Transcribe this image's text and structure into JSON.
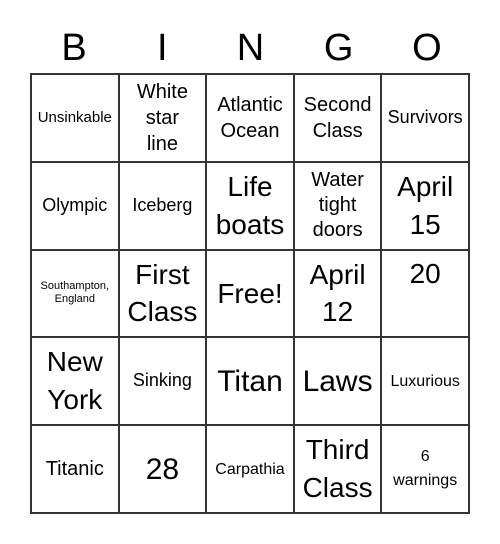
{
  "header": [
    "B",
    "I",
    "N",
    "G",
    "O"
  ],
  "cells": [
    "Unsinkable",
    "White star line",
    "Atlantic Ocean",
    "Second Class",
    "Survivors",
    "Olympic",
    "Iceberg",
    "Life boats",
    "Water tight doors",
    "April 15",
    "Southampton, England",
    "First Class",
    "Free!",
    "April 12",
    "20",
    "New York",
    "Sinking",
    "Titan",
    "Laws",
    "Luxurious",
    "Titanic",
    "28",
    "Carpathia",
    "Third Class",
    "6 warnings"
  ]
}
